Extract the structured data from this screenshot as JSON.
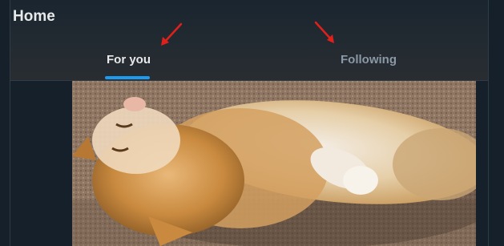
{
  "header": {
    "title": "Home",
    "tabs": [
      {
        "label": "For you",
        "selected": true
      },
      {
        "label": "Following",
        "selected": false
      }
    ]
  },
  "colors": {
    "background": "#15202b",
    "accent": "#1d9bf0",
    "text_primary": "#e7e9ea",
    "text_secondary": "#8b98a5",
    "annotation_arrow": "#e0201a"
  }
}
